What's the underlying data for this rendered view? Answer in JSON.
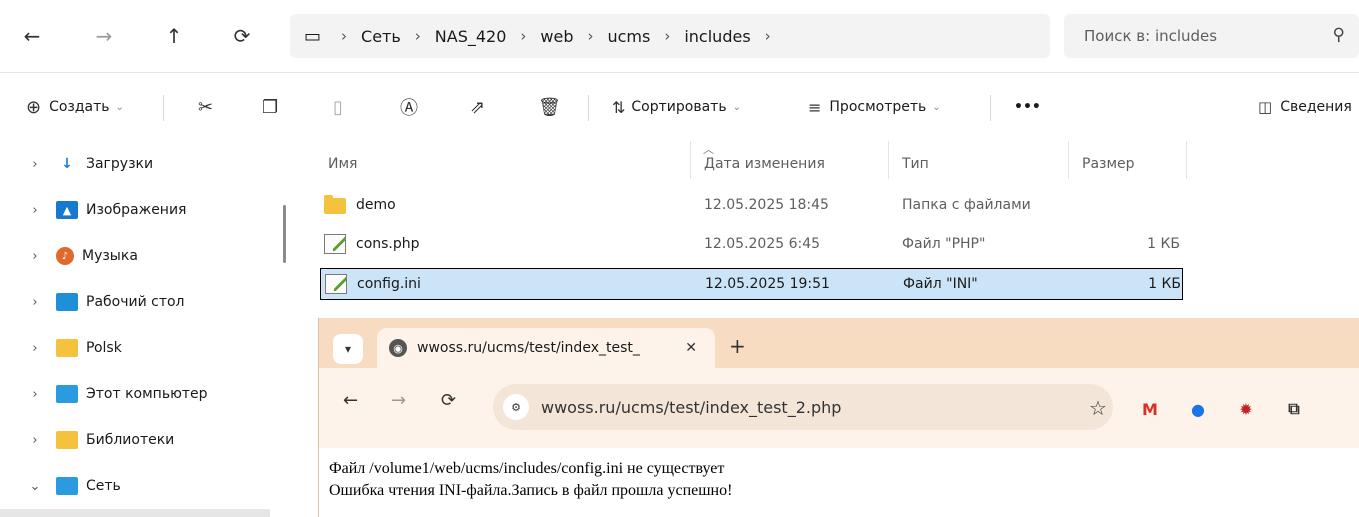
{
  "address": {
    "crumbs": [
      "Сеть",
      "NAS_420",
      "web",
      "ucms",
      "includes"
    ],
    "search_placeholder": "Поиск в: includes"
  },
  "toolbar": {
    "create_label": "Создать",
    "sort_label": "Сортировать",
    "view_label": "Просмотреть",
    "more_label": "•••",
    "details_label": "Сведения"
  },
  "sidebar": {
    "items": [
      {
        "label": "Загрузки",
        "icon": "download-icon",
        "expanded": false
      },
      {
        "label": "Изображения",
        "icon": "pictures-icon",
        "expanded": false
      },
      {
        "label": "Музыка",
        "icon": "music-icon",
        "expanded": false
      },
      {
        "label": "Рабочий стол",
        "icon": "desktop-icon",
        "expanded": false
      },
      {
        "label": "Polsk",
        "icon": "folder-icon",
        "expanded": false
      },
      {
        "label": "Этот компьютер",
        "icon": "computer-icon",
        "expanded": false
      },
      {
        "label": "Библиотеки",
        "icon": "library-icon",
        "expanded": false
      },
      {
        "label": "Сеть",
        "icon": "network-icon",
        "expanded": true
      }
    ]
  },
  "filelist": {
    "headers": {
      "name": "Имя",
      "date": "Дата изменения",
      "type": "Тип",
      "size": "Размер"
    },
    "rows": [
      {
        "name": "demo",
        "date": "12.05.2025 18:45",
        "type": "Папка с файлами",
        "size": "",
        "icon": "folder-icon",
        "selected": false
      },
      {
        "name": "cons.php",
        "date": "12.05.2025 6:45",
        "type": "Файл \"PHP\"",
        "size": "1 КБ",
        "icon": "text-file-icon",
        "selected": false
      },
      {
        "name": "config.ini",
        "date": "12.05.2025 19:51",
        "type": "Файл \"INI\"",
        "size": "1 КБ",
        "icon": "text-file-icon",
        "selected": true
      }
    ]
  },
  "browser": {
    "tab_title": "wwoss.ru/ucms/test/index_test_",
    "url": "wwoss.ru/ucms/test/index_test_2.php",
    "content_lines": [
      "Файл /volume1/web/ucms/includes/config.ini не существует",
      "Ошибка чтения INI-файла.Запись в файл прошла успешно!"
    ]
  },
  "colors": {
    "accent_tab": "#f8dcc2",
    "selection": "#cce4f7",
    "folder": "#f4c23d"
  }
}
